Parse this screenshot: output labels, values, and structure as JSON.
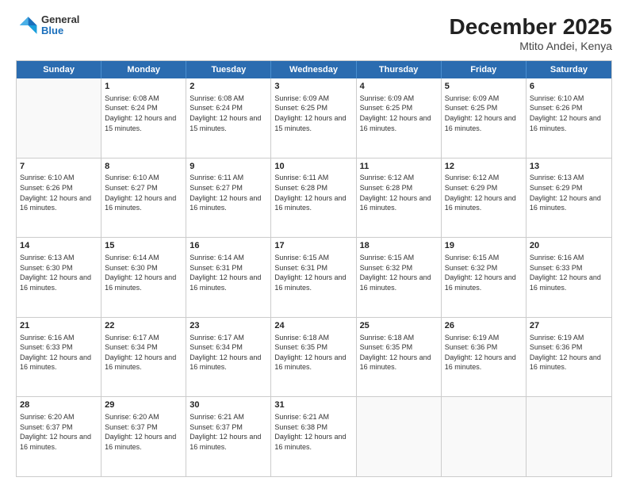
{
  "header": {
    "logo": {
      "general": "General",
      "blue": "Blue"
    },
    "title": "December 2025",
    "location": "Mtito Andei, Kenya"
  },
  "weekdays": [
    "Sunday",
    "Monday",
    "Tuesday",
    "Wednesday",
    "Thursday",
    "Friday",
    "Saturday"
  ],
  "rows": [
    [
      {
        "day": "",
        "empty": true
      },
      {
        "day": "1",
        "sunrise": "6:08 AM",
        "sunset": "6:24 PM",
        "daylight": "12 hours and 15 minutes."
      },
      {
        "day": "2",
        "sunrise": "6:08 AM",
        "sunset": "6:24 PM",
        "daylight": "12 hours and 15 minutes."
      },
      {
        "day": "3",
        "sunrise": "6:09 AM",
        "sunset": "6:25 PM",
        "daylight": "12 hours and 15 minutes."
      },
      {
        "day": "4",
        "sunrise": "6:09 AM",
        "sunset": "6:25 PM",
        "daylight": "12 hours and 16 minutes."
      },
      {
        "day": "5",
        "sunrise": "6:09 AM",
        "sunset": "6:25 PM",
        "daylight": "12 hours and 16 minutes."
      },
      {
        "day": "6",
        "sunrise": "6:10 AM",
        "sunset": "6:26 PM",
        "daylight": "12 hours and 16 minutes."
      }
    ],
    [
      {
        "day": "7",
        "sunrise": "6:10 AM",
        "sunset": "6:26 PM",
        "daylight": "12 hours and 16 minutes."
      },
      {
        "day": "8",
        "sunrise": "6:10 AM",
        "sunset": "6:27 PM",
        "daylight": "12 hours and 16 minutes."
      },
      {
        "day": "9",
        "sunrise": "6:11 AM",
        "sunset": "6:27 PM",
        "daylight": "12 hours and 16 minutes."
      },
      {
        "day": "10",
        "sunrise": "6:11 AM",
        "sunset": "6:28 PM",
        "daylight": "12 hours and 16 minutes."
      },
      {
        "day": "11",
        "sunrise": "6:12 AM",
        "sunset": "6:28 PM",
        "daylight": "12 hours and 16 minutes."
      },
      {
        "day": "12",
        "sunrise": "6:12 AM",
        "sunset": "6:29 PM",
        "daylight": "12 hours and 16 minutes."
      },
      {
        "day": "13",
        "sunrise": "6:13 AM",
        "sunset": "6:29 PM",
        "daylight": "12 hours and 16 minutes."
      }
    ],
    [
      {
        "day": "14",
        "sunrise": "6:13 AM",
        "sunset": "6:30 PM",
        "daylight": "12 hours and 16 minutes."
      },
      {
        "day": "15",
        "sunrise": "6:14 AM",
        "sunset": "6:30 PM",
        "daylight": "12 hours and 16 minutes."
      },
      {
        "day": "16",
        "sunrise": "6:14 AM",
        "sunset": "6:31 PM",
        "daylight": "12 hours and 16 minutes."
      },
      {
        "day": "17",
        "sunrise": "6:15 AM",
        "sunset": "6:31 PM",
        "daylight": "12 hours and 16 minutes."
      },
      {
        "day": "18",
        "sunrise": "6:15 AM",
        "sunset": "6:32 PM",
        "daylight": "12 hours and 16 minutes."
      },
      {
        "day": "19",
        "sunrise": "6:15 AM",
        "sunset": "6:32 PM",
        "daylight": "12 hours and 16 minutes."
      },
      {
        "day": "20",
        "sunrise": "6:16 AM",
        "sunset": "6:33 PM",
        "daylight": "12 hours and 16 minutes."
      }
    ],
    [
      {
        "day": "21",
        "sunrise": "6:16 AM",
        "sunset": "6:33 PM",
        "daylight": "12 hours and 16 minutes."
      },
      {
        "day": "22",
        "sunrise": "6:17 AM",
        "sunset": "6:34 PM",
        "daylight": "12 hours and 16 minutes."
      },
      {
        "day": "23",
        "sunrise": "6:17 AM",
        "sunset": "6:34 PM",
        "daylight": "12 hours and 16 minutes."
      },
      {
        "day": "24",
        "sunrise": "6:18 AM",
        "sunset": "6:35 PM",
        "daylight": "12 hours and 16 minutes."
      },
      {
        "day": "25",
        "sunrise": "6:18 AM",
        "sunset": "6:35 PM",
        "daylight": "12 hours and 16 minutes."
      },
      {
        "day": "26",
        "sunrise": "6:19 AM",
        "sunset": "6:36 PM",
        "daylight": "12 hours and 16 minutes."
      },
      {
        "day": "27",
        "sunrise": "6:19 AM",
        "sunset": "6:36 PM",
        "daylight": "12 hours and 16 minutes."
      }
    ],
    [
      {
        "day": "28",
        "sunrise": "6:20 AM",
        "sunset": "6:37 PM",
        "daylight": "12 hours and 16 minutes."
      },
      {
        "day": "29",
        "sunrise": "6:20 AM",
        "sunset": "6:37 PM",
        "daylight": "12 hours and 16 minutes."
      },
      {
        "day": "30",
        "sunrise": "6:21 AM",
        "sunset": "6:37 PM",
        "daylight": "12 hours and 16 minutes."
      },
      {
        "day": "31",
        "sunrise": "6:21 AM",
        "sunset": "6:38 PM",
        "daylight": "12 hours and 16 minutes."
      },
      {
        "day": "",
        "empty": true
      },
      {
        "day": "",
        "empty": true
      },
      {
        "day": "",
        "empty": true
      }
    ]
  ],
  "labels": {
    "sunrise": "Sunrise:",
    "sunset": "Sunset:",
    "daylight": "Daylight:"
  }
}
